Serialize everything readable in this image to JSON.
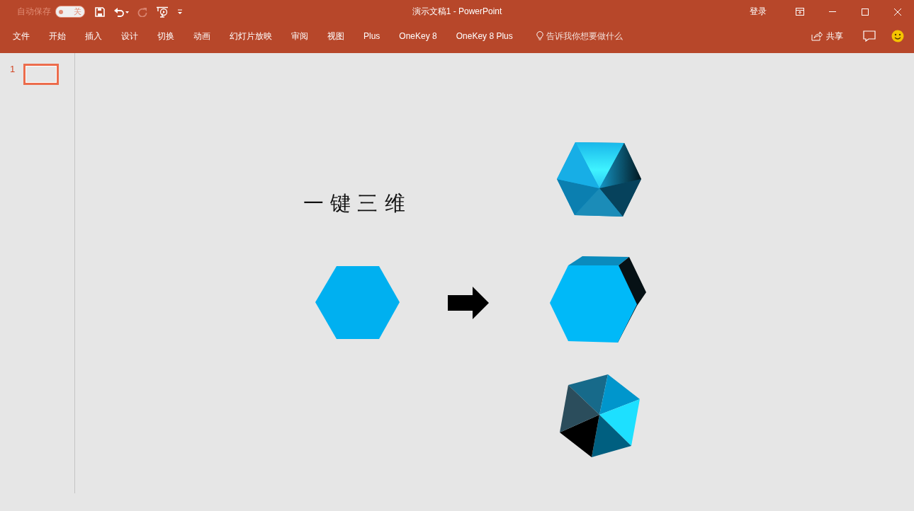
{
  "autosave": {
    "label": "自动保存",
    "on": false,
    "toggle_text": "关"
  },
  "quick_access": [
    {
      "kind": "save",
      "disabled": false
    },
    {
      "kind": "undo",
      "disabled": false
    },
    {
      "kind": "redo",
      "disabled": true
    },
    {
      "kind": "present",
      "disabled": false
    },
    {
      "kind": "customize",
      "disabled": false
    }
  ],
  "window": {
    "title": "演示文稿1  -  PowerPoint",
    "sign_in": "登录"
  },
  "tabs": [
    {
      "label": "文件"
    },
    {
      "label": "开始"
    },
    {
      "label": "插入"
    },
    {
      "label": "设计"
    },
    {
      "label": "切换"
    },
    {
      "label": "动画"
    },
    {
      "label": "幻灯片放映"
    },
    {
      "label": "审阅"
    },
    {
      "label": "视图"
    },
    {
      "label": "Plus"
    },
    {
      "label": "OneKey 8"
    },
    {
      "label": "OneKey 8 Plus"
    }
  ],
  "tell_me": {
    "placeholder": "告诉我你想要做什么"
  },
  "share": {
    "label": "共享"
  },
  "slides": [
    {
      "number": "1",
      "selected": true
    }
  ],
  "slide": {
    "title": "一 键 三 维",
    "shapes": [
      {
        "kind": "flat-hexagon"
      },
      {
        "kind": "arrow"
      },
      {
        "kind": "beveled-hexagon"
      },
      {
        "kind": "extruded-hexagon"
      },
      {
        "kind": "pyramid-hexagon"
      }
    ]
  }
}
